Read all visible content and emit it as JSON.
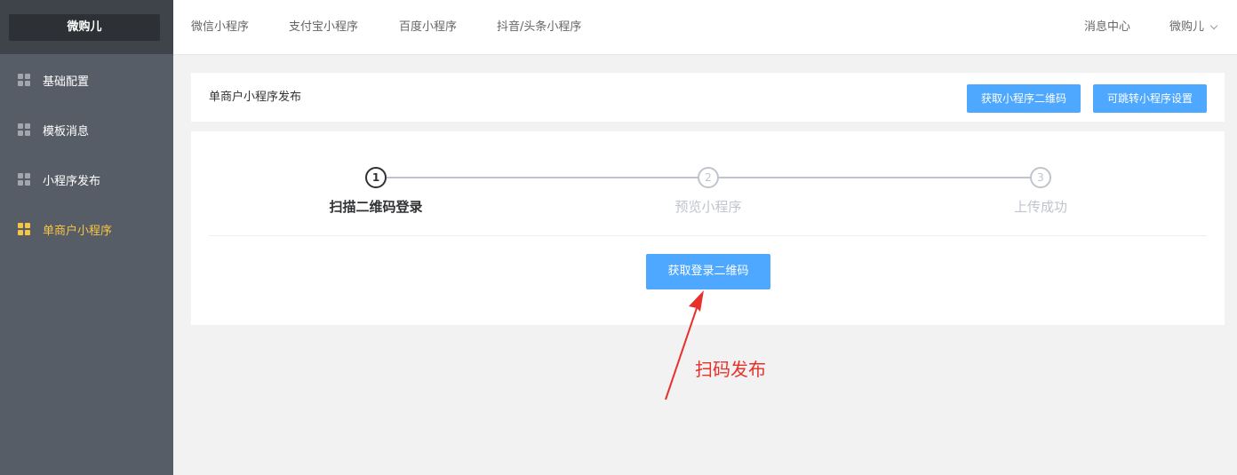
{
  "sidebar": {
    "brand": "微购儿",
    "items": [
      {
        "label": "基础配置",
        "active": false
      },
      {
        "label": "模板消息",
        "active": false
      },
      {
        "label": "小程序发布",
        "active": false
      },
      {
        "label": "单商户小程序",
        "active": true
      }
    ]
  },
  "header": {
    "tabs": [
      {
        "label": "微信小程序"
      },
      {
        "label": "支付宝小程序"
      },
      {
        "label": "百度小程序"
      },
      {
        "label": "抖音/头条小程序"
      }
    ],
    "message_center": "消息中心",
    "user": "微购儿"
  },
  "title_card": {
    "title": "单商户小程序发布",
    "qrcode_button": "获取小程序二维码",
    "jump_settings_button": "可跳转小程序设置"
  },
  "steps": [
    {
      "number": "1",
      "label": "扫描二维码登录",
      "status": "done"
    },
    {
      "number": "2",
      "label": "预览小程序",
      "status": "wait"
    },
    {
      "number": "3",
      "label": "上传成功",
      "status": "wait"
    }
  ],
  "main": {
    "login_qrcode_button": "获取登录二维码"
  },
  "annotation": {
    "text": "扫码发布",
    "color": "#e8302a"
  },
  "colors": {
    "primary_button": "#4ea8ff",
    "sidebar_bg": "#575d66",
    "sidebar_active": "#f7c544"
  }
}
